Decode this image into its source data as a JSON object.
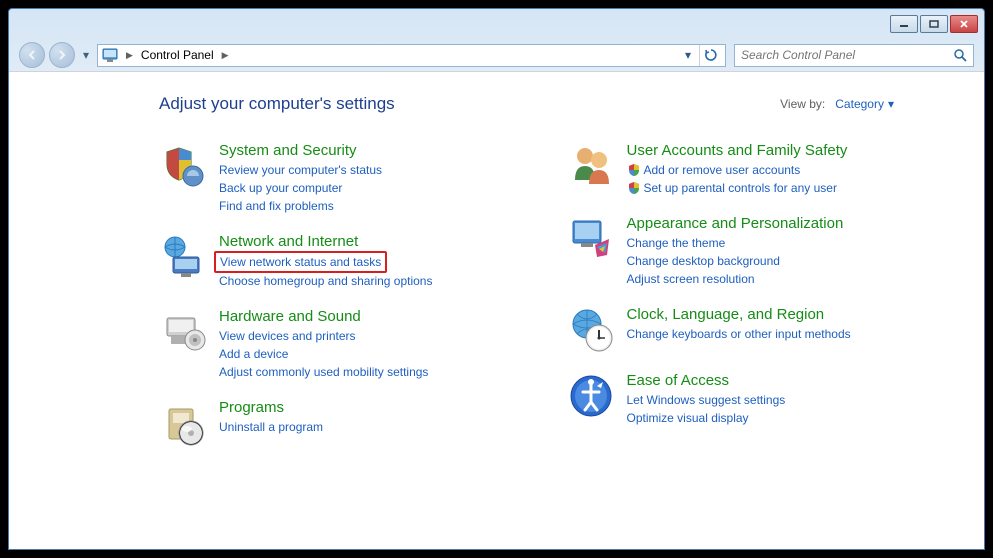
{
  "breadcrumb": {
    "root": "Control Panel"
  },
  "search": {
    "placeholder": "Search Control Panel"
  },
  "header": {
    "title": "Adjust your computer's settings",
    "viewby_label": "View by:",
    "viewby_value": "Category"
  },
  "left_column": [
    {
      "icon": "system-security",
      "title": "System and Security",
      "links": [
        {
          "text": "Review your computer's status"
        },
        {
          "text": "Back up your computer"
        },
        {
          "text": "Find and fix problems"
        }
      ]
    },
    {
      "icon": "network",
      "title": "Network and Internet",
      "links": [
        {
          "text": "View network status and tasks",
          "highlighted": true
        },
        {
          "text": "Choose homegroup and sharing options"
        }
      ]
    },
    {
      "icon": "hardware",
      "title": "Hardware and Sound",
      "links": [
        {
          "text": "View devices and printers"
        },
        {
          "text": "Add a device"
        },
        {
          "text": "Adjust commonly used mobility settings"
        }
      ]
    },
    {
      "icon": "programs",
      "title": "Programs",
      "links": [
        {
          "text": "Uninstall a program"
        }
      ]
    }
  ],
  "right_column": [
    {
      "icon": "users",
      "title": "User Accounts and Family Safety",
      "links": [
        {
          "text": "Add or remove user accounts",
          "shield": true
        },
        {
          "text": "Set up parental controls for any user",
          "shield": true
        }
      ]
    },
    {
      "icon": "appearance",
      "title": "Appearance and Personalization",
      "links": [
        {
          "text": "Change the theme"
        },
        {
          "text": "Change desktop background"
        },
        {
          "text": "Adjust screen resolution"
        }
      ]
    },
    {
      "icon": "clock",
      "title": "Clock, Language, and Region",
      "links": [
        {
          "text": "Change keyboards or other input methods"
        }
      ]
    },
    {
      "icon": "ease",
      "title": "Ease of Access",
      "links": [
        {
          "text": "Let Windows suggest settings"
        },
        {
          "text": "Optimize visual display"
        }
      ]
    }
  ]
}
